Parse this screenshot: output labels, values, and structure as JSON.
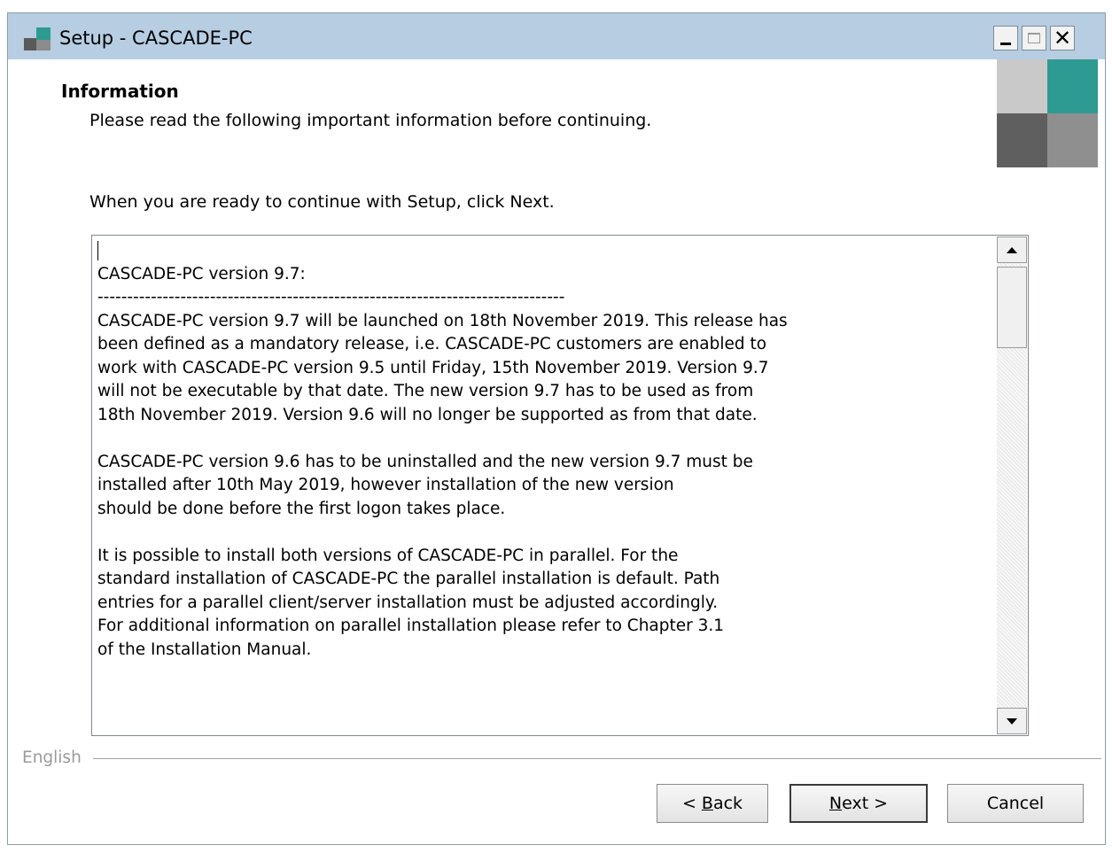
{
  "window": {
    "title": "Setup - CASCADE-PC",
    "icon": "setup-app-icon",
    "controls": [
      "minimize-icon",
      "maximize-icon",
      "close-icon"
    ]
  },
  "header": {
    "title": "Information",
    "subtitle": "Please read the following important information before continuing.",
    "logo_colors": [
      "#c9c9c9",
      "#2e9b93",
      "#5f5f5f",
      "#8f8f8f"
    ]
  },
  "instruction": "When you are ready to continue with Setup, click Next.",
  "memo": {
    "lines": [
      "",
      "CASCADE-PC version 9.7:",
      "-------------------------------------------------------------------------------",
      "CASCADE-PC version 9.7 will be launched on 18th November 2019. This release has",
      "been defined as a mandatory release, i.e. CASCADE-PC customers are enabled to",
      "work with CASCADE-PC version 9.5 until Friday, 15th November 2019. Version 9.7",
      "will not be executable by that date. The new version 9.7 has to be used as from",
      "18th November 2019. Version 9.6 will no longer be supported as from that date.",
      "",
      "CASCADE-PC version 9.6 has to be uninstalled and the new version 9.7 must be",
      "installed after 10th May 2019, however installation of the new version",
      "should be done before the first logon takes place.",
      "",
      "It is possible to install both versions of CASCADE-PC in parallel. For the",
      "standard installation of CASCADE-PC the parallel installation is default. Path",
      "entries for a parallel client/server installation must be adjusted accordingly.",
      "For additional information on parallel installation please refer to Chapter 3.1",
      "of the Installation Manual."
    ]
  },
  "language_label": "English",
  "buttons": {
    "back": {
      "pre": "< ",
      "accel": "B",
      "post": "ack"
    },
    "next": {
      "pre": "",
      "accel": "N",
      "post": "ext >"
    },
    "cancel": "Cancel"
  }
}
